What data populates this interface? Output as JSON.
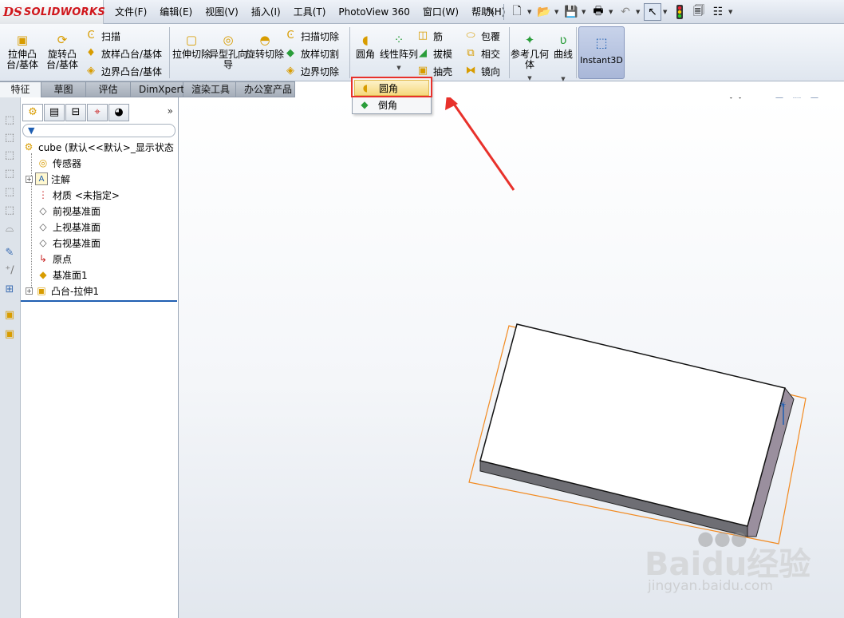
{
  "app": {
    "brand_prefix": "DS",
    "brand_name": "SOLIDWORKS"
  },
  "menu": [
    {
      "label": "文件(F)"
    },
    {
      "label": "编辑(E)"
    },
    {
      "label": "视图(V)"
    },
    {
      "label": "插入(I)"
    },
    {
      "label": "工具(T)"
    },
    {
      "label": "PhotoView 360"
    },
    {
      "label": "窗口(W)"
    },
    {
      "label": "帮助(H)"
    }
  ],
  "toolbar_icons": [
    "pin-icon",
    "new-document-icon",
    "open-folder-icon",
    "save-icon",
    "print-icon",
    "undo-icon",
    "select-arrow-icon",
    "rebuild-traffic-light-icon",
    "file-properties-icon",
    "options-icon"
  ],
  "commands": {
    "extrude_boss": "拉伸凸台/基体",
    "revolve_boss": "旋转凸台/基体",
    "sweep": "扫描",
    "loft_boss": "放样凸台/基体",
    "boundary_boss": "边界凸台/基体",
    "extrude_cut": "拉伸切除",
    "hole_wizard": "异型孔向导",
    "revolve_cut": "旋转切除",
    "swept_cut": "扫描切除",
    "lofted_cut": "放样切割",
    "boundary_cut": "边界切除",
    "fillet": "圆角",
    "linear_pattern": "线性阵列",
    "rib": "筋",
    "draft": "拔模",
    "shell": "抽壳",
    "wrap": "包覆",
    "intersect": "相交",
    "mirror": "镜向",
    "ref_geometry": "参考几何体",
    "curves": "曲线",
    "instant3d": "Instant3D"
  },
  "tabs": [
    {
      "label": "特征",
      "active": true
    },
    {
      "label": "草图",
      "active": false
    },
    {
      "label": "评估",
      "active": false
    },
    {
      "label": "DimXpert",
      "active": false
    },
    {
      "label": "渲染工具",
      "active": false
    },
    {
      "label": "办公室产品",
      "active": false
    }
  ],
  "fillet_dropdown": [
    {
      "label": "圆角",
      "icon": "fillet-icon",
      "highlighted": true
    },
    {
      "label": "倒角",
      "icon": "chamfer-icon",
      "highlighted": false
    }
  ],
  "feature_tree": {
    "root": "cube  (默认<<默认>_显示状态",
    "items": [
      {
        "label": "传感器",
        "icon": "sensor-icon",
        "expandable": false
      },
      {
        "label": "注解",
        "icon": "annotation-icon",
        "expandable": true
      },
      {
        "label": "材质 <未指定>",
        "icon": "material-icon",
        "expandable": false
      },
      {
        "label": "前视基准面",
        "icon": "plane-icon",
        "expandable": false
      },
      {
        "label": "上视基准面",
        "icon": "plane-icon",
        "expandable": false
      },
      {
        "label": "右视基准面",
        "icon": "plane-icon",
        "expandable": false
      },
      {
        "label": "原点",
        "icon": "origin-icon",
        "expandable": false
      },
      {
        "label": "基准面1",
        "icon": "plane-yellow-icon",
        "expandable": false
      },
      {
        "label": "凸台-拉伸1",
        "icon": "extrude-icon",
        "expandable": true
      }
    ]
  },
  "watermark": {
    "text": "Baidu经验",
    "url": "jingyan.baidu.com"
  },
  "colors": {
    "highlight_box": "#e8312b",
    "arrow": "#e8312b",
    "plane_outline": "#f28a20",
    "accent": "#1f5fb2"
  }
}
